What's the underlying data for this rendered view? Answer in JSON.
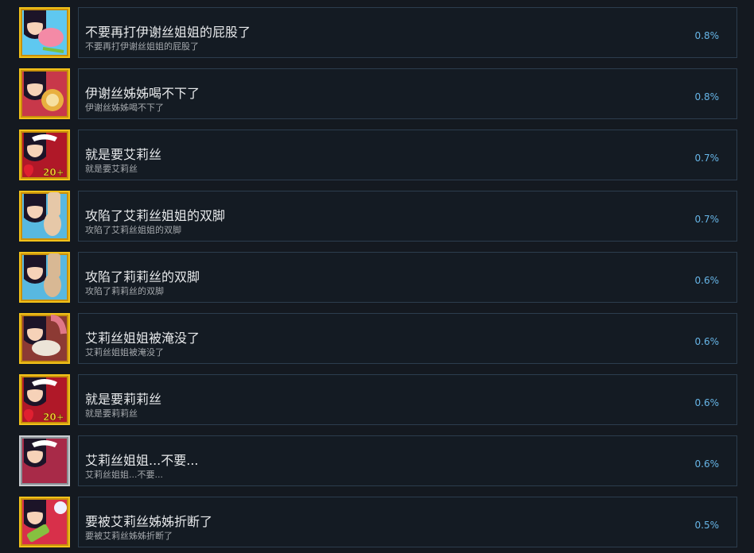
{
  "achievements": [
    {
      "title": "不要再打伊谢丝姐姐的屁股了",
      "description": "不要再打伊谢丝姐姐的屁股了",
      "percent": "0.8%",
      "icon": "sister-spank-icon",
      "icon_frame": "gold",
      "icon_bg": "#5fc8f0",
      "prop_color": "#f48aa6"
    },
    {
      "title": "伊谢丝姊姊喝不下了",
      "description": "伊谢丝姊姊喝不下了",
      "percent": "0.8%",
      "icon": "sister-drink-icon",
      "icon_frame": "gold",
      "icon_bg": "#c8384a",
      "prop_color": "#e8b040"
    },
    {
      "title": "就是要艾莉丝",
      "description": "就是要艾莉丝",
      "percent": "0.7%",
      "icon": "heart-20-plus-icon",
      "icon_frame": "gold",
      "icon_bg": "#b01828",
      "prop_color": "#e02030"
    },
    {
      "title": "攻陷了艾莉丝姐姐的双脚",
      "description": "攻陷了艾莉丝姐姐的双脚",
      "percent": "0.7%",
      "icon": "feet-icon",
      "icon_frame": "gold",
      "icon_bg": "#58b8e0",
      "prop_color": "#e6c8a8"
    },
    {
      "title": "攻陷了莉莉丝的双脚",
      "description": "攻陷了莉莉丝的双脚",
      "percent": "0.6%",
      "icon": "feet-icon",
      "icon_frame": "gold",
      "icon_bg": "#58b8e0",
      "prop_color": "#d8b894"
    },
    {
      "title": "艾莉丝姐姐被淹没了",
      "description": "艾莉丝姐姐被淹没了",
      "percent": "0.6%",
      "icon": "drowned-icon",
      "icon_frame": "gold",
      "icon_bg": "#8c3a34",
      "prop_color": "#6a4030"
    },
    {
      "title": "就是要莉莉丝",
      "description": "就是要莉莉丝",
      "percent": "0.6%",
      "icon": "heart-20-plus-icon",
      "icon_frame": "gold",
      "icon_bg": "#b01828",
      "prop_color": "#e02030"
    },
    {
      "title": "艾莉丝姐姐...不要...",
      "description": "艾莉丝姐姐...不要...",
      "percent": "0.6%",
      "icon": "maid-icon",
      "icon_frame": "silver",
      "icon_bg": "#a82a48",
      "prop_color": "#c89060"
    },
    {
      "title": "要被艾莉丝姊姊折断了",
      "description": "要被艾莉丝姊姊折断了",
      "percent": "0.5%",
      "icon": "broken-icon",
      "icon_frame": "gold",
      "icon_bg": "#d8304a",
      "prop_color": "#86c040"
    }
  ]
}
